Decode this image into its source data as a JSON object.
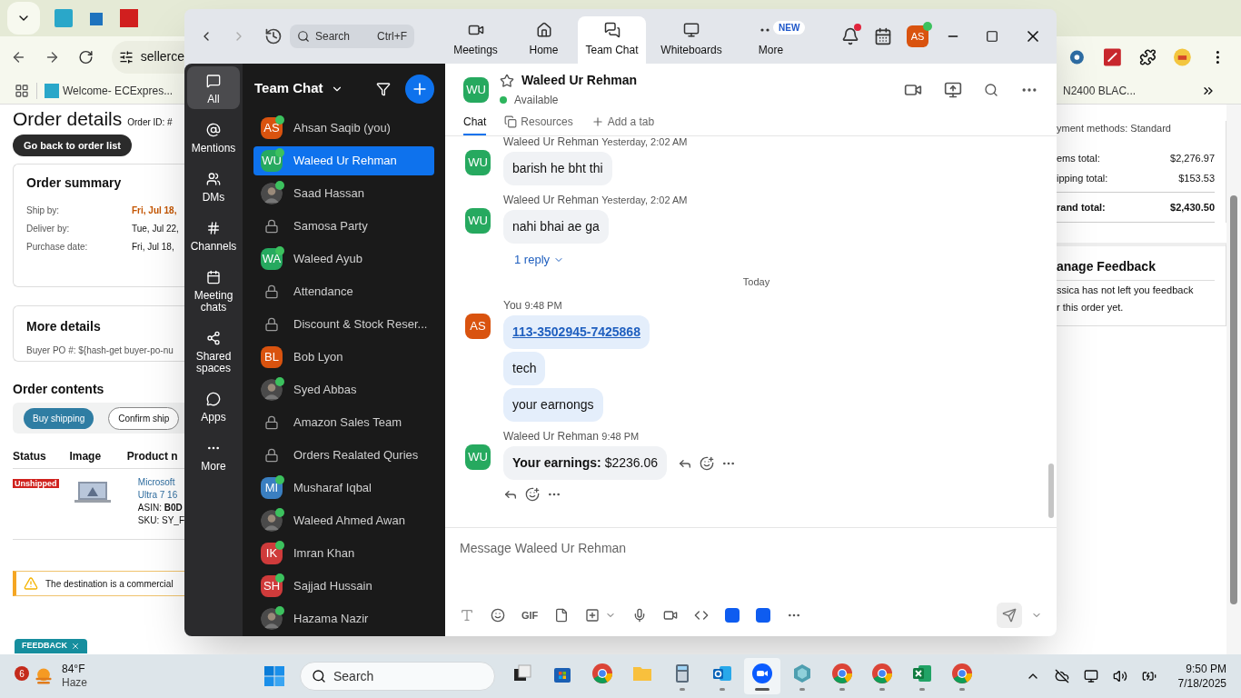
{
  "browser": {
    "address": "sellerce",
    "bookmarks": [
      {
        "label": "Welcome- ECExpres..."
      },
      {
        "label": "N2400 BLAC..."
      }
    ],
    "page_left": {
      "title": "Order details",
      "order_id": "Order ID: #",
      "back_button": "Go back to order list",
      "summary": {
        "title": "Order summary",
        "rows": [
          {
            "label": "Ship by:",
            "value": "Fri, Jul 18,",
            "kind": "urgent"
          },
          {
            "label": "Deliver by:",
            "value": "Tue, Jul 22,",
            "kind": "plain"
          },
          {
            "label": "Purchase date:",
            "value": "Fri, Jul 18,",
            "kind": "plain"
          }
        ]
      },
      "more_details": {
        "title": "More details",
        "label": "Buyer PO #:",
        "value": "${hash-get buyer-po-nu"
      },
      "contents_title": "Order contents",
      "buttons": [
        {
          "label": "Buy shipping",
          "kind": "primary"
        },
        {
          "label": "Confirm ship",
          "kind": "outline"
        }
      ],
      "table": {
        "columns": [
          "Status",
          "Image",
          "Product n"
        ],
        "rows": [
          {
            "status": "Unshipped",
            "product": [
              "Microsoft",
              "Ultra 7 16"
            ],
            "asin_label": "ASIN:",
            "asin": "B0D",
            "sku": "SKU: SY_F"
          }
        ]
      },
      "warning": "The destination is a commercial",
      "feedback_tab": "FEEDBACK"
    },
    "page_right": {
      "payment": "yment methods: Standard",
      "totals": [
        {
          "label": "ems total:",
          "value": "$2,276.97",
          "kind": "plain"
        },
        {
          "label": "ipping total:",
          "value": "$153.53",
          "kind": "plain"
        },
        {
          "label": "rand total:",
          "value": "$2,430.50",
          "kind": "total"
        }
      ],
      "feedback_title": "anage Feedback",
      "feedback_lines": [
        "ssica has not left you feedback",
        "r this order yet."
      ]
    }
  },
  "zoom": {
    "search": {
      "placeholder": "Search",
      "shortcut": "Ctrl+F"
    },
    "nav": [
      {
        "label": "Meetings",
        "kind": "meetings",
        "selected": false
      },
      {
        "label": "Home",
        "kind": "home",
        "selected": false
      },
      {
        "label": "Team Chat",
        "kind": "chat",
        "selected": true
      },
      {
        "label": "Whiteboards",
        "kind": "whiteboard",
        "selected": false
      },
      {
        "label": "More",
        "kind": "more",
        "selected": false,
        "badge": "NEW"
      }
    ],
    "notifications": true,
    "profile": {
      "initials": "AS",
      "color": "#d9530f",
      "online": true
    },
    "rail": [
      {
        "label": "All",
        "kind": "all",
        "selected": true
      },
      {
        "label": "Mentions",
        "kind": "mentions",
        "selected": false
      },
      {
        "label": "DMs",
        "kind": "dms",
        "selected": false
      },
      {
        "label": "Channels",
        "kind": "channels",
        "selected": false
      },
      {
        "label": "Meeting chats",
        "kind": "meetings",
        "selected": false
      },
      {
        "label": "Shared spaces",
        "kind": "shared",
        "selected": false
      },
      {
        "label": "Apps",
        "kind": "apps",
        "selected": false
      },
      {
        "label": "More",
        "kind": "more",
        "selected": false
      }
    ],
    "list_title": "Team Chat",
    "contacts": [
      {
        "name": "Ahsan Saqib (you)",
        "kind": "initials",
        "initials": "AS",
        "color": "#d9530f",
        "online": true,
        "selected": false
      },
      {
        "name": "Waleed Ur Rehman",
        "kind": "initials",
        "initials": "WU",
        "color": "#26a95f",
        "online": true,
        "selected": true
      },
      {
        "name": "Saad Hassan",
        "online": true,
        "selected": false
      },
      {
        "name": "Samosa Party",
        "kind": "channel",
        "selected": false
      },
      {
        "name": "Waleed Ayub",
        "kind": "initials",
        "initials": "WA",
        "color": "#26a95f",
        "online": true,
        "selected": false
      },
      {
        "name": "Attendance",
        "kind": "channel",
        "selected": false
      },
      {
        "name": "Discount & Stock Reser...",
        "kind": "channel",
        "selected": false
      },
      {
        "name": "Bob Lyon",
        "kind": "initials",
        "initials": "BL",
        "color": "#d9530f",
        "online": false,
        "selected": false
      },
      {
        "name": "Syed Abbas",
        "online": true,
        "selected": false
      },
      {
        "name": "Amazon Sales Team",
        "kind": "channel",
        "selected": false
      },
      {
        "name": "Orders Realated Quries",
        "kind": "channel",
        "selected": false
      },
      {
        "name": "Musharaf Iqbal",
        "kind": "initials",
        "initials": "MI",
        "color": "#3a7fc1",
        "online": true,
        "selected": false
      },
      {
        "name": "Waleed Ahmed Awan",
        "online": true,
        "selected": false
      },
      {
        "name": "Imran Khan",
        "kind": "initials",
        "initials": "IK",
        "color": "#cf3b3b",
        "online": true,
        "selected": false
      },
      {
        "name": "Sajjad Hussain",
        "kind": "initials",
        "initials": "SH",
        "color": "#cf3b3b",
        "online": true,
        "selected": false
      },
      {
        "name": "Hazama Nazir",
        "online": true,
        "selected": false
      }
    ],
    "chat": {
      "name": "Waleed Ur Rehman",
      "initials": "WU",
      "color": "#26a95f",
      "status": "Available",
      "tabs": [
        {
          "label": "Chat",
          "kind": "chat",
          "selected": true
        },
        {
          "label": "Resources",
          "kind": "resources",
          "selected": false
        },
        {
          "label": "Add a tab",
          "kind": "add",
          "selected": false
        }
      ],
      "messages": [
        {
          "kind": "group",
          "sender": "Waleed Ur Rehman",
          "time": "Yesterday, 2:02 AM",
          "initials": "WU",
          "color": "#26a95f",
          "mine": false,
          "bubbles": [
            {
              "kind": "text",
              "text": "barish he bht thi"
            }
          ]
        },
        {
          "kind": "group",
          "sender": "Waleed Ur Rehman",
          "time": "Yesterday, 2:02 AM",
          "initials": "WU",
          "color": "#26a95f",
          "mine": false,
          "bubbles": [
            {
              "kind": "text",
              "text": "nahi bhai ae ga"
            }
          ],
          "reply": "1 reply"
        },
        {
          "kind": "divider",
          "text": "Today"
        },
        {
          "kind": "group",
          "sender": "You",
          "time": "9:48 PM",
          "initials": "AS",
          "color": "#d9530f",
          "mine": true,
          "bubbles": [
            {
              "kind": "link",
              "text": "113-3502945-7425868"
            },
            {
              "kind": "text",
              "text": "tech"
            },
            {
              "kind": "text",
              "text": "your earnongs"
            }
          ]
        },
        {
          "kind": "group",
          "sender": "Waleed Ur Rehman",
          "time": "9:48 PM",
          "initials": "WU",
          "color": "#26a95f",
          "mine": false,
          "actions": true,
          "bubbles": [
            {
              "kind": "text",
              "text": "**Your earnings:** $2236.06"
            }
          ]
        }
      ],
      "composer": {
        "placeholder": "Message Waleed Ur Rehman",
        "gif": "GIF"
      }
    }
  },
  "taskbar": {
    "weather": {
      "badge": "6",
      "temp": "84°F",
      "condition": "Haze"
    },
    "search": {
      "placeholder": "Search"
    },
    "apps": [
      {
        "kind": "taskview",
        "running": false,
        "selected": false
      },
      {
        "kind": "store",
        "running": false,
        "selected": false
      },
      {
        "kind": "chrome",
        "running": false,
        "selected": false
      },
      {
        "kind": "files",
        "running": false,
        "selected": false
      },
      {
        "kind": "calculator",
        "running": true,
        "selected": false
      },
      {
        "kind": "outlook",
        "running": true,
        "selected": false
      },
      {
        "kind": "zoom",
        "running": true,
        "selected": true
      },
      {
        "kind": "app",
        "running": true,
        "selected": false
      },
      {
        "kind": "chrome",
        "running": true,
        "selected": false
      },
      {
        "kind": "chrome",
        "running": true,
        "selected": false
      },
      {
        "kind": "excel",
        "running": true,
        "selected": false
      },
      {
        "kind": "chrome",
        "running": true,
        "selected": false
      }
    ],
    "time": "9:50 PM",
    "date": "7/18/2025"
  }
}
